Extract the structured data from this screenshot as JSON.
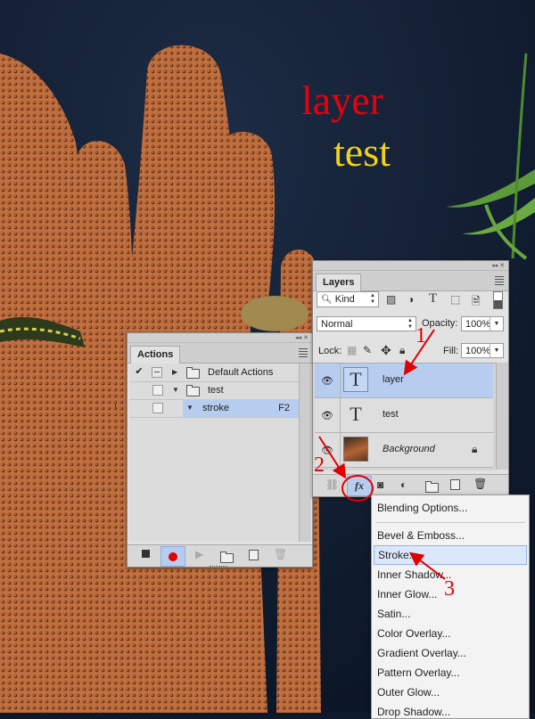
{
  "canvas_text": {
    "line1": "layer",
    "line2": "test",
    "line1_color": "#e8000b",
    "line2_color": "#f2d21a"
  },
  "actions_panel": {
    "tab_label": "Actions",
    "rows": [
      {
        "label": "Default Actions",
        "checked": true
      },
      {
        "label": "test",
        "checked": false
      },
      {
        "label": "stroke",
        "shortcut": "F2",
        "checked": false
      }
    ],
    "record_color": "#e00000"
  },
  "layers_panel": {
    "tab_label": "Layers",
    "filter_kind": "Kind",
    "blend_mode": "Normal",
    "opacity_label": "Opacity:",
    "opacity_value": "100%",
    "lock_label": "Lock:",
    "fill_label": "Fill:",
    "fill_value": "100%",
    "layers": [
      {
        "name": "layer",
        "type": "text",
        "selected": true
      },
      {
        "name": "test",
        "type": "text",
        "selected": false
      },
      {
        "name": "Background",
        "type": "image",
        "locked": true
      }
    ],
    "fx_label": "fx"
  },
  "fx_menu": {
    "items": [
      "Blending Options...",
      "Bevel & Emboss...",
      "Stroke...",
      "Inner Shadow...",
      "Inner Glow...",
      "Satin...",
      "Color Overlay...",
      "Gradient Overlay...",
      "Pattern Overlay...",
      "Outer Glow...",
      "Drop Shadow..."
    ],
    "highlighted": "Stroke..."
  },
  "annotations": {
    "step1": "1",
    "step2": "2",
    "step3": "3",
    "color": "#e10000"
  },
  "thumb_glyph": "T"
}
